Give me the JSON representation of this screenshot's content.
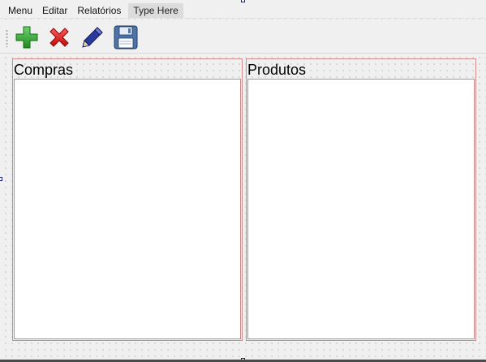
{
  "menubar": {
    "items": [
      {
        "label": "Menu"
      },
      {
        "label": "Editar"
      },
      {
        "label": "Relatórios"
      },
      {
        "label": "Type Here"
      }
    ]
  },
  "toolbar": {
    "buttons": [
      {
        "icon": "plus-icon",
        "color": "#2e9e2e"
      },
      {
        "icon": "delete-x-icon",
        "color": "#d01818"
      },
      {
        "icon": "pencil-icon",
        "color": "#22308a"
      },
      {
        "icon": "floppy-disk-icon",
        "color": "#3a5a8c"
      }
    ]
  },
  "panels": {
    "compras": {
      "title": "Compras"
    },
    "produtos": {
      "title": "Produtos"
    }
  },
  "colors": {
    "designer_border": "#d08c8c",
    "selection_handle": "#1a237e"
  }
}
